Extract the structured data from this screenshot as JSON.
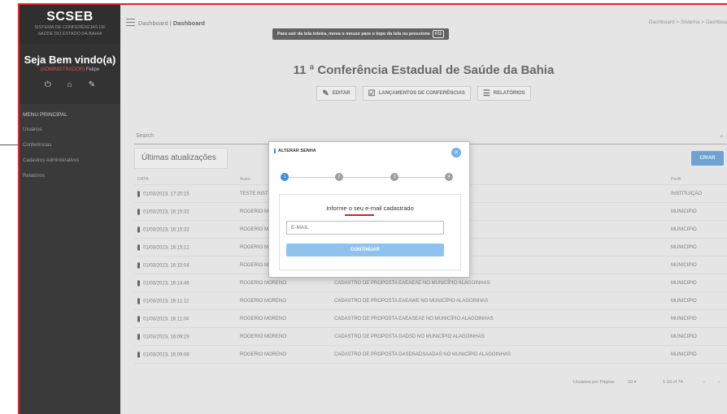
{
  "sidebar": {
    "brand_title": "SCSEB",
    "brand_subtitle_1": "SISTEMA DE CONFERÊNCIAS DE",
    "brand_subtitle_2": "SAÚDE DO ESTADO DA BAHIA",
    "welcome": "Seja Bem vindo(a)",
    "user_role": "(ADMINISTRADOR)",
    "user_name": "Felipe",
    "menu_header": "MENU PRINCIPAL",
    "items": [
      {
        "label": "Usuários"
      },
      {
        "label": "Conferências"
      },
      {
        "label": "Cadastros Administrativos"
      },
      {
        "label": "Relatórios"
      }
    ]
  },
  "topbar": {
    "crumb_prefix": "Dashboard |",
    "crumb_current": "Dashboard",
    "crumb_right": "Dashboard  >  Sistema  >  Dashboa",
    "fullscreen_text": "Para sair da tela inteira, mova o mouse para o topo da tela ou pressione",
    "fullscreen_key": "F11"
  },
  "main": {
    "title": "11 ª Conferência Estadual de Saúde da Bahia",
    "actions": [
      {
        "label": "EDITAR",
        "icon": "pencil-icon"
      },
      {
        "label": "LANÇAMENTOS DE CONFERÊNCIAS",
        "icon": "calendar-check-icon"
      },
      {
        "label": "RELATÓRIOS",
        "icon": "list-icon"
      }
    ],
    "search_label": "Search",
    "updates_tab": "Últimas atualizações",
    "create_label": "CRIAR",
    "columns": {
      "date": "DATA",
      "autor": "Autor",
      "desc": "",
      "perfil": "Perfil"
    },
    "rows": [
      {
        "date": "01/03/2023, 17:20:15",
        "autor": "TESTE INSTITUIÇÃ",
        "desc": "W NA INSTITUIÇÃO SESAB",
        "perfil": "INSTITUIÇÃO"
      },
      {
        "date": "01/03/2023, 16:15:32",
        "autor": "ROGERIO MORENO",
        "desc": "IAS",
        "perfil": "MUNICIPIO"
      },
      {
        "date": "01/03/2023, 16:15:32",
        "autor": "ROGERIO MORENO",
        "desc": "IAS",
        "perfil": "MUNICIPIO"
      },
      {
        "date": "01/03/2023, 16:15:12",
        "autor": "ROGERIO MORENO",
        "desc": "ALAGOINHAS",
        "perfil": "MUNICIPIO"
      },
      {
        "date": "01/03/2023, 16:15:04",
        "autor": "ROGERIO MORENO",
        "desc": "LAGOINHAS",
        "perfil": "MUNICIPIO"
      },
      {
        "date": "01/03/2023, 16:14:46",
        "autor": "ROGERIO MORENO",
        "desc": "CADASTRO DE PROPOSTA EAEAEAE NO MUNICÍPIO ALAGOINHAS",
        "perfil": "MUNICIPIO"
      },
      {
        "date": "01/03/2023, 16:11:12",
        "autor": "ROGERIO MORENO",
        "desc": "CADASTRO DE PROPOSTA EAEAWE NO MUNICÍPIO ALAGOINHAS",
        "perfil": "MUNICIPIO"
      },
      {
        "date": "01/03/2023, 16:11:04",
        "autor": "ROGERIO MORENO",
        "desc": "CADASTRO DE PROPOSTA EAEASEAE NO MUNICÍPIO ALAGOINHAS",
        "perfil": "MUNICIPIO"
      },
      {
        "date": "01/03/2023, 16:09:29",
        "autor": "ROGERIO MORENO",
        "desc": "CADASTRO DE PROPOSTA DADSD NO MUNICÍPIO ALAGOINHAS",
        "perfil": "MUNICIPIO"
      },
      {
        "date": "01/03/2023, 16:09:08",
        "autor": "ROGERIO MORENO",
        "desc": "CADASTRO DE PROPOSTA DASDSADSAADAS NO MUNICÍPIO ALAGOINHAS",
        "perfil": "MUNICIPIO"
      }
    ],
    "pager": {
      "rows_label": "Usuários por Página:",
      "rows_value": "10",
      "range": "1-10 of 74"
    }
  },
  "modal": {
    "title": "ALTERAR SENHA",
    "steps": [
      "1",
      "2",
      "3",
      "4"
    ],
    "prompt": "Informe o seu e-mail cadastrado",
    "email_placeholder": "E-MAIL",
    "continue_label": "CONTINUAR"
  },
  "colors": {
    "accent": "#3b8fd9",
    "frame": "#e0262a",
    "sidebar": "#3a3a3a"
  }
}
